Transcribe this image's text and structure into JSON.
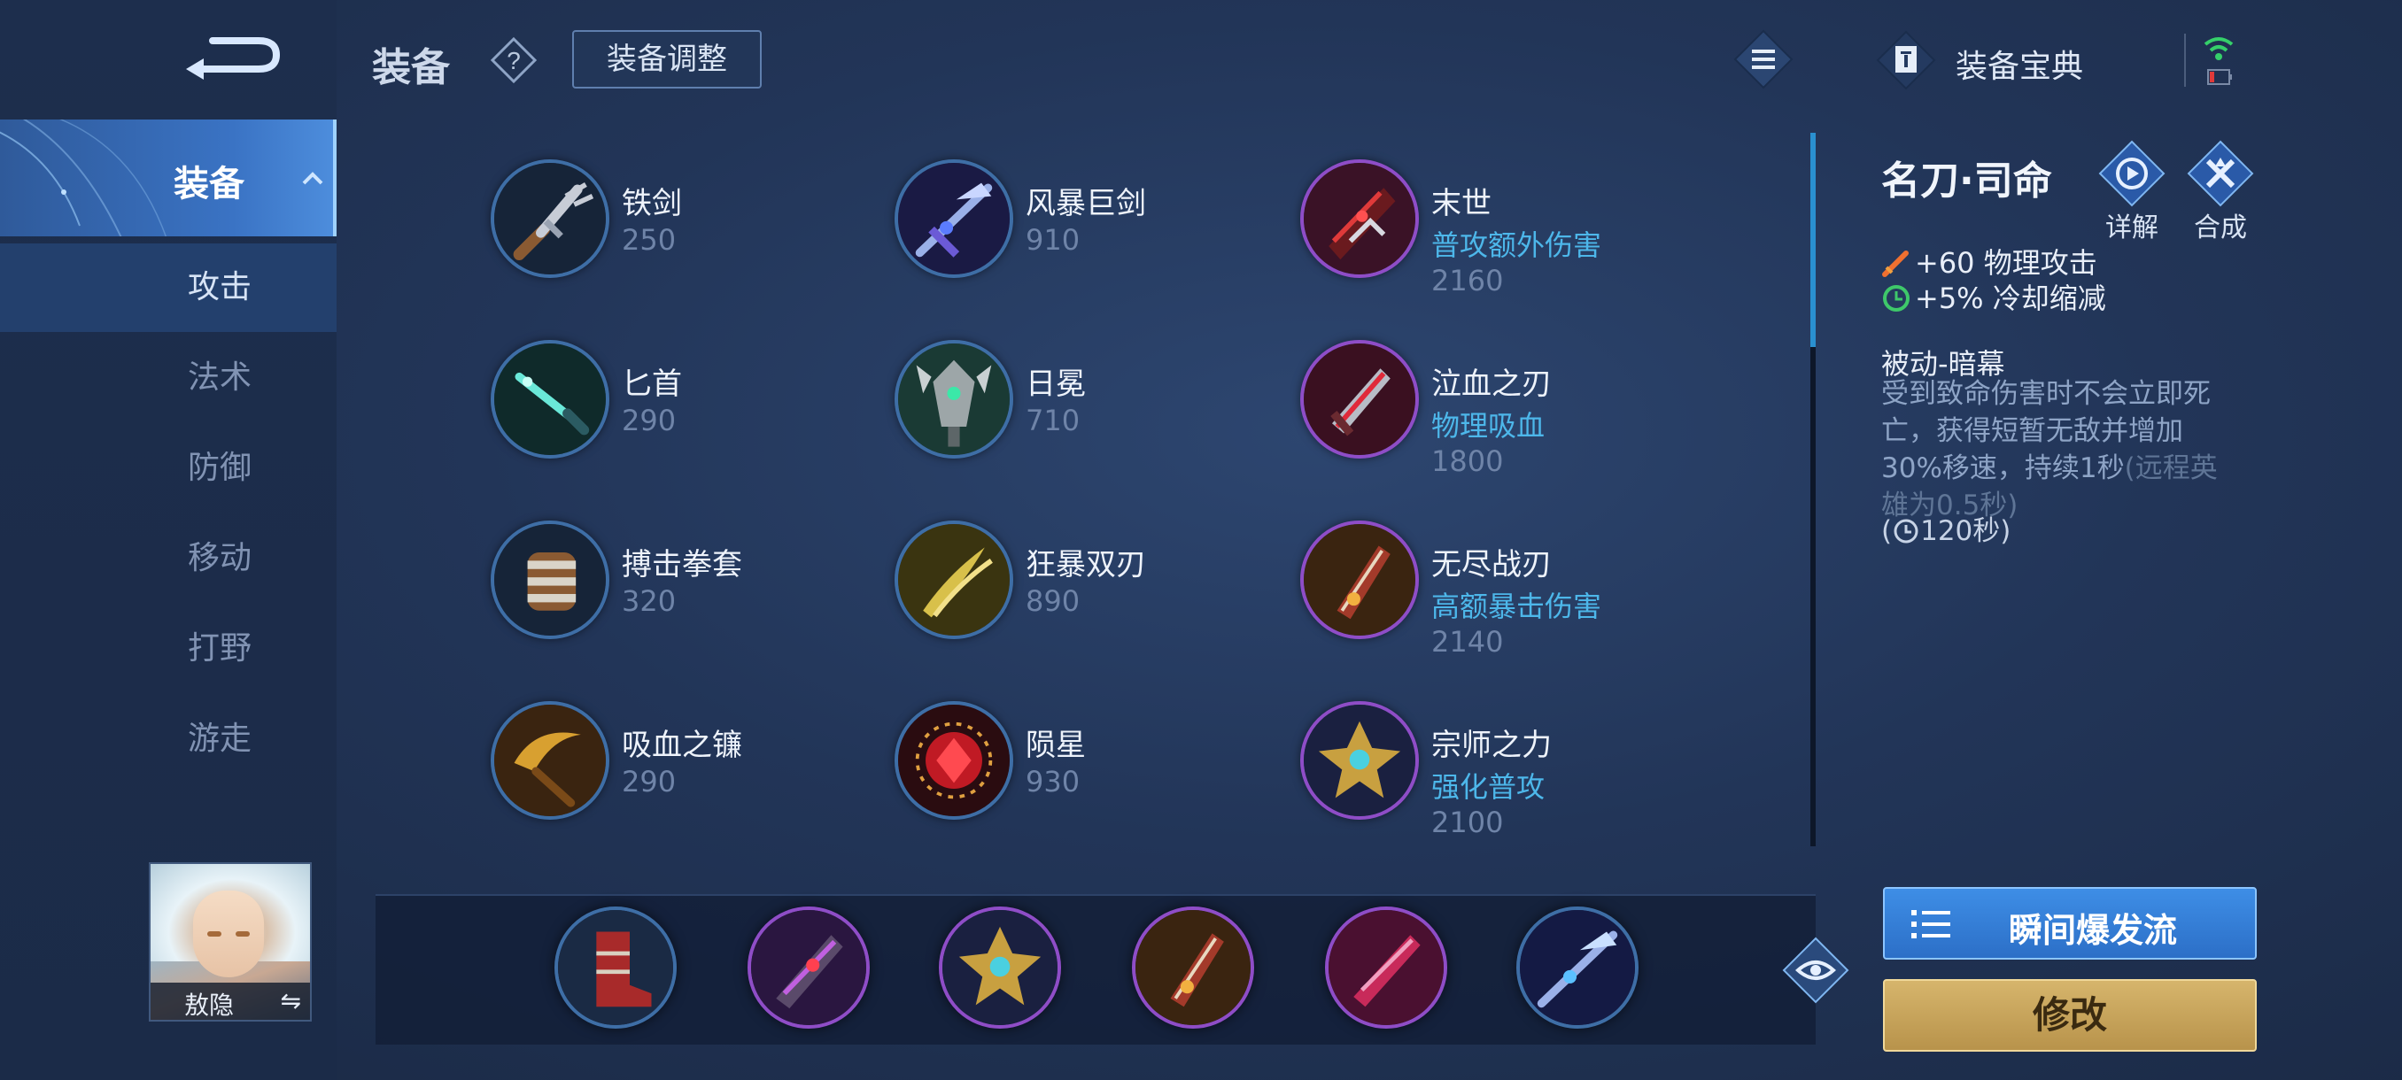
{
  "header": {
    "title": "装备",
    "adjust_label": "装备调整",
    "codex_label": "装备宝典"
  },
  "sidebar": {
    "active_label": "装备",
    "items": [
      {
        "label": "攻击",
        "selected": true
      },
      {
        "label": "法术"
      },
      {
        "label": "防御"
      },
      {
        "label": "移动"
      },
      {
        "label": "打野"
      },
      {
        "label": "游走"
      }
    ],
    "hero_name": "敖隐",
    "swap_symbol": "⇋"
  },
  "items": [
    {
      "name": "铁剑",
      "price": "250",
      "effect": ""
    },
    {
      "name": "风暴巨剑",
      "price": "910",
      "effect": ""
    },
    {
      "name": "末世",
      "price": "2160",
      "effect": "普攻额外伤害"
    },
    {
      "name": "匕首",
      "price": "290",
      "effect": ""
    },
    {
      "name": "日冕",
      "price": "710",
      "effect": ""
    },
    {
      "name": "泣血之刃",
      "price": "1800",
      "effect": "物理吸血"
    },
    {
      "name": "搏击拳套",
      "price": "320",
      "effect": ""
    },
    {
      "name": "狂暴双刃",
      "price": "890",
      "effect": ""
    },
    {
      "name": "无尽战刃",
      "price": "2140",
      "effect": "高额暴击伤害"
    },
    {
      "name": "吸血之镰",
      "price": "290",
      "effect": ""
    },
    {
      "name": "陨星",
      "price": "930",
      "effect": ""
    },
    {
      "name": "宗师之力",
      "price": "2100",
      "effect": "强化普攻"
    }
  ],
  "detail": {
    "name": "名刀·司命",
    "detail_btn": "详解",
    "compose_btn": "合成",
    "stats": [
      "+60 物理攻击",
      "+5% 冷却缩减"
    ],
    "passive_title": "被动-暗幕",
    "passive_text_main": "受到致命伤害时不会立即死亡，获得短暂无敌并增加30%移速，持续1秒",
    "passive_text_dim": "(远程英雄为0.5秒)",
    "cooldown_open": "(",
    "cooldown": "120秒)"
  },
  "build": {
    "plan_label": "瞬间爆发流",
    "modify_label": "修改"
  },
  "colors": {
    "accent_blue": "#4db7ea",
    "price_gray": "#6f84a8",
    "gold_button": "#c9a55e",
    "plan_button": "#3580d8"
  }
}
